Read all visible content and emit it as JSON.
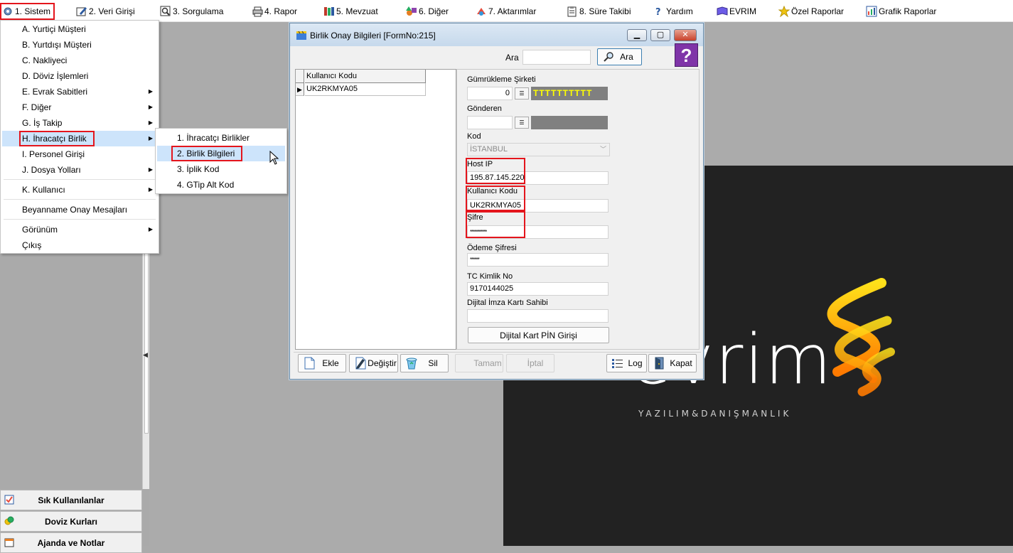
{
  "menubar": {
    "items": [
      {
        "label": "1.  Sistem"
      },
      {
        "label": "2.  Veri Girişi"
      },
      {
        "label": "3.  Sorgulama"
      },
      {
        "label": "4.  Rapor"
      },
      {
        "label": "5.  Mevzuat"
      },
      {
        "label": "6.  Diğer"
      },
      {
        "label": "7.  Aktarımlar"
      },
      {
        "label": "8. Süre Takibi"
      },
      {
        "label": "Yardım"
      },
      {
        "label": "EVRIM"
      },
      {
        "label": "Özel Raporlar"
      },
      {
        "label": "Grafik Raporlar"
      }
    ]
  },
  "sistem_menu": {
    "items": [
      {
        "label": "A.  Yurtiçi Müşteri"
      },
      {
        "label": "B.  Yurtdışı Müşteri"
      },
      {
        "label": "C.  Nakliyeci"
      },
      {
        "label": "D.  Döviz İşlemleri"
      },
      {
        "label": "E.  Evrak Sabitleri"
      },
      {
        "label": "F.  Diğer"
      },
      {
        "label": "G.  İş Takip"
      },
      {
        "label": "H.  İhracatçı Birlik"
      },
      {
        "label": "I.   Personel Girişi"
      },
      {
        "label": "J.  Dosya Yolları"
      },
      {
        "label": "K.  Kullanıcı"
      },
      {
        "label": "Beyanname Onay Mesajları"
      },
      {
        "label": "Görünüm"
      },
      {
        "label": "Çıkış"
      }
    ]
  },
  "birlik_submenu": {
    "items": [
      {
        "label": "1.   İhracatçı Birlikler"
      },
      {
        "label": "2.   Birlik Bilgileri"
      },
      {
        "label": "3.   İplik Kod"
      },
      {
        "label": "4.   GTip Alt Kod"
      }
    ]
  },
  "left_panel": {
    "buttons": [
      {
        "label": "Sık Kullanılanlar"
      },
      {
        "label": "Doviz Kurları"
      },
      {
        "label": "Ajanda ve Notlar"
      }
    ]
  },
  "form": {
    "title": "Birlik Onay Bilgileri [FormNo:215]",
    "search_label": "Ara",
    "search_value": "",
    "search_button": "Ara",
    "help_glyph": "?",
    "grid": {
      "column": "Kullanıcı Kodu",
      "rows": [
        "UK2RKMYA05"
      ]
    },
    "fields": {
      "gumrukleme_label": "Gümrükleme Şirketi",
      "gumrukleme_code": "0",
      "gumrukleme_name": "TTTTTTTTTT",
      "gonderen_label": "Gönderen",
      "gonderen_code": "",
      "kod_label": "Kod",
      "kod_value": "İSTANBUL",
      "host_ip_label": "Host IP",
      "host_ip_value": "195.87.145.220",
      "kullanici_kodu_label": "Kullanıcı Kodu",
      "kullanici_kodu_value": "UK2RKMYA05",
      "sifre_label": "Şifre",
      "sifre_value": "***********",
      "odeme_sifresi_label": "Ödeme Şifresi",
      "odeme_sifresi_value": "******",
      "tc_label": "TC Kimlik No",
      "tc_value": "9170144025",
      "dijital_imza_label": "Dijital İmza Kartı Sahibi",
      "dijital_imza_value": "",
      "pin_button": "Dijital Kart PİN Girişi"
    },
    "buttons": {
      "ekle": "Ekle",
      "degistir": "Değiştir",
      "sil": "Sil",
      "tamam": "Tamam",
      "iptal": "İptal",
      "log": "Log",
      "kapat": "Kapat"
    }
  },
  "brand": {
    "logo_text": "evrim",
    "tagline": "YAZILIM&DANIŞMANLIK"
  },
  "colors": {
    "highlight_red": "#e4151c",
    "menu_selected": "#cde4fb",
    "gumrukleme_name_text": "#ffff00",
    "gumrukleme_name_bg": "#808080",
    "dark_panel": "#222222"
  }
}
